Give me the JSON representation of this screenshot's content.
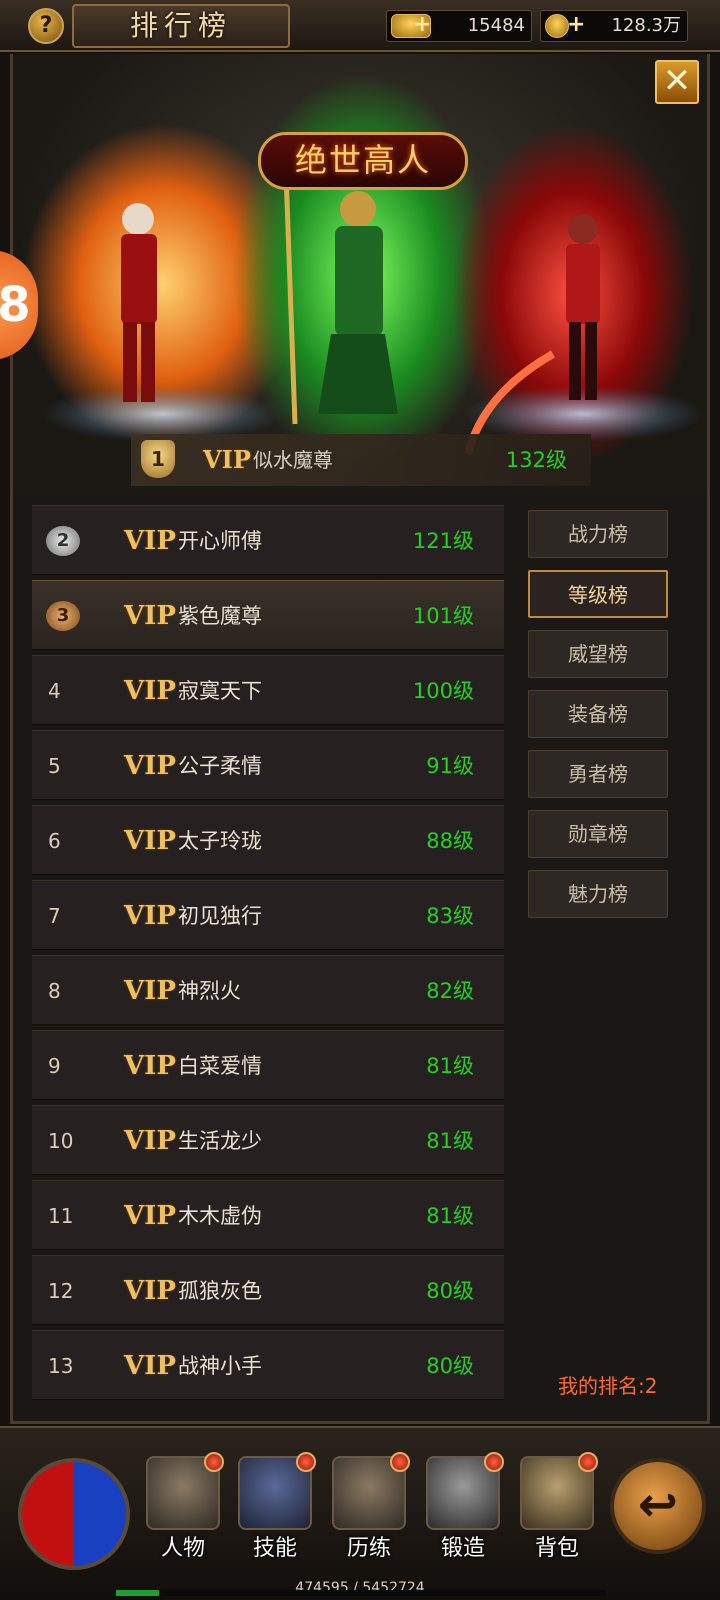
{
  "header": {
    "help_icon": "question-mark-icon",
    "help_label": "?",
    "title": "排行榜",
    "gold_ingot": {
      "icon": "gold-ingot-icon",
      "plus": "+",
      "value": "15484"
    },
    "coins": {
      "icon": "copper-coin-icon",
      "plus": "+",
      "value": "128.3万"
    }
  },
  "close": {
    "icon": "close-x-icon",
    "label": "✕"
  },
  "hero": {
    "banner": "绝世高人",
    "side_badge": "8"
  },
  "first_place": {
    "rank": "1",
    "vip": "VIP",
    "name": "似水魔尊",
    "level": "132级"
  },
  "rankings": [
    {
      "rank": "2",
      "vip": "VIP",
      "name": "开心师傅",
      "level": "121级"
    },
    {
      "rank": "3",
      "vip": "VIP",
      "name": "紫色魔尊",
      "level": "101级"
    },
    {
      "rank": "4",
      "vip": "VIP",
      "name": "寂寞天下",
      "level": "100级"
    },
    {
      "rank": "5",
      "vip": "VIP",
      "name": "公子柔情",
      "level": "91级"
    },
    {
      "rank": "6",
      "vip": "VIP",
      "name": "太子玲珑",
      "level": "88级"
    },
    {
      "rank": "7",
      "vip": "VIP",
      "name": "初见独行",
      "level": "83级"
    },
    {
      "rank": "8",
      "vip": "VIP",
      "name": "神烈火",
      "level": "82级"
    },
    {
      "rank": "9",
      "vip": "VIP",
      "name": "白菜爱情",
      "level": "81级"
    },
    {
      "rank": "10",
      "vip": "VIP",
      "name": "生活龙少",
      "level": "81级"
    },
    {
      "rank": "11",
      "vip": "VIP",
      "name": "木木虚伪",
      "level": "81级"
    },
    {
      "rank": "12",
      "vip": "VIP",
      "name": "孤狼灰色",
      "level": "80级"
    },
    {
      "rank": "13",
      "vip": "VIP",
      "name": "战神小手",
      "level": "80级"
    }
  ],
  "tabs": [
    {
      "label": "战力榜",
      "active": false
    },
    {
      "label": "等级榜",
      "active": true
    },
    {
      "label": "威望榜",
      "active": false
    },
    {
      "label": "装备榜",
      "active": false
    },
    {
      "label": "勇者榜",
      "active": false
    },
    {
      "label": "勋章榜",
      "active": false
    },
    {
      "label": "魅力榜",
      "active": false
    }
  ],
  "my_rank": "我的排名:2",
  "bottom_nav": [
    {
      "label": "人物",
      "icon": "helmet-icon"
    },
    {
      "label": "技能",
      "icon": "skill-book-icon"
    },
    {
      "label": "历练",
      "icon": "armor-icon"
    },
    {
      "label": "锻造",
      "icon": "anvil-icon"
    },
    {
      "label": "背包",
      "icon": "backpack-icon"
    }
  ],
  "experience": {
    "text": "474595 / 5452724",
    "progress": 0.087
  },
  "back": {
    "icon": "back-arrow-icon",
    "label": "↩"
  },
  "colors": {
    "level_green": "#23d023",
    "vip_gold": "#f0c060",
    "my_rank_orange": "#ff6a2a",
    "active_tab_border": "#c08a3a"
  }
}
